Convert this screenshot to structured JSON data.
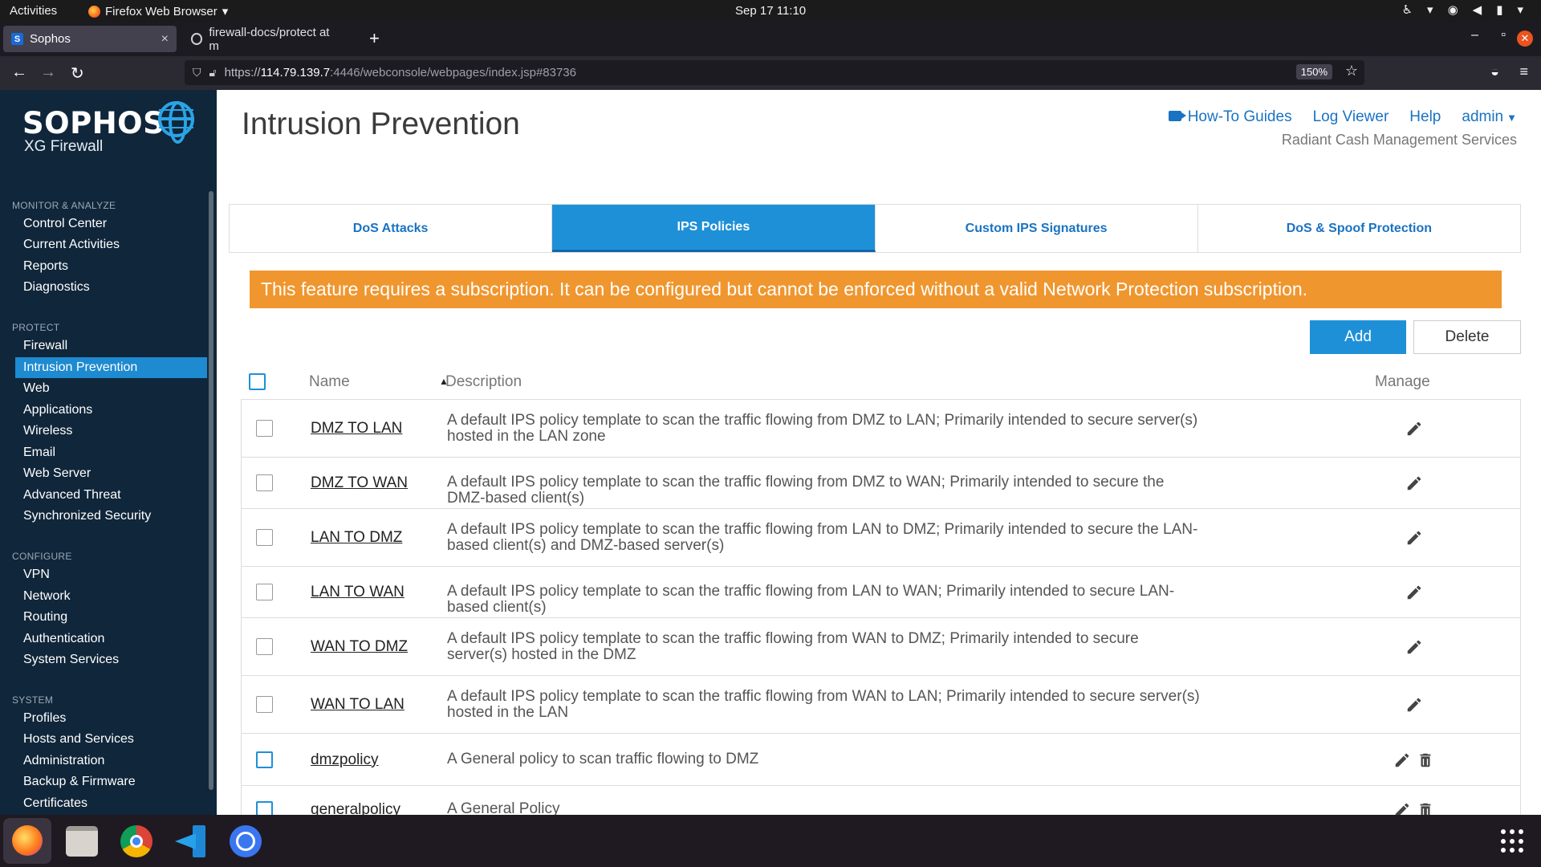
{
  "os": {
    "activities": "Activities",
    "app_menu": "Firefox Web Browser",
    "clock": "Sep 17  11:10"
  },
  "browser": {
    "tabs": [
      {
        "title": "Sophos",
        "favicon": "S"
      },
      {
        "title": "firewall-docs/protect at m"
      }
    ],
    "url_proto": "https://",
    "url_host": "114.79.139.7",
    "url_rest": ":4446/webconsole/webpages/index.jsp#83736",
    "zoom": "150%"
  },
  "sidebar": {
    "logo": "SOPHOS",
    "product": "XG Firewall",
    "sections": [
      {
        "label": "MONITOR & ANALYZE",
        "items": [
          "Control Center",
          "Current Activities",
          "Reports",
          "Diagnostics"
        ]
      },
      {
        "label": "PROTECT",
        "items": [
          "Firewall",
          "Intrusion Prevention",
          "Web",
          "Applications",
          "Wireless",
          "Email",
          "Web Server",
          "Advanced Threat",
          "Synchronized Security"
        ]
      },
      {
        "label": "CONFIGURE",
        "items": [
          "VPN",
          "Network",
          "Routing",
          "Authentication",
          "System Services"
        ]
      },
      {
        "label": "SYSTEM",
        "items": [
          "Profiles",
          "Hosts and Services",
          "Administration",
          "Backup & Firmware",
          "Certificates"
        ]
      }
    ],
    "active_item": "Intrusion Prevention"
  },
  "header": {
    "title": "Intrusion Prevention",
    "links": {
      "howto": "How-To Guides",
      "logviewer": "Log Viewer",
      "help": "Help",
      "user": "admin"
    },
    "organization": "Radiant Cash Management Services"
  },
  "tabs": [
    "DoS Attacks",
    "IPS Policies",
    "Custom IPS Signatures",
    "DoS & Spoof Protection"
  ],
  "active_tab": "IPS Policies",
  "banner": "This feature requires a subscription. It can be configured but cannot be enforced without a valid Network Protection subscription.",
  "actions": {
    "add": "Add",
    "delete": "Delete"
  },
  "table": {
    "columns": {
      "name": "Name",
      "description": "Description",
      "manage": "Manage"
    },
    "rows": [
      {
        "name": "DMZ TO LAN",
        "description": "A default IPS policy template to scan the traffic flowing from DMZ to LAN; Primarily intended to secure server(s) hosted in the LAN zone",
        "deletable": false
      },
      {
        "name": "DMZ TO WAN",
        "description": "A default IPS policy template to scan the traffic flowing from DMZ to WAN; Primarily intended to secure the DMZ-based client(s)",
        "deletable": false
      },
      {
        "name": "LAN TO DMZ",
        "description": "A default IPS policy template to scan the traffic flowing from LAN to DMZ; Primarily intended to secure the LAN-based client(s) and DMZ-based server(s)",
        "deletable": false
      },
      {
        "name": "LAN TO WAN",
        "description": "A default IPS policy template to scan the traffic flowing from LAN to WAN; Primarily intended to secure LAN-based client(s)",
        "deletable": false
      },
      {
        "name": "WAN TO DMZ",
        "description": "A default IPS policy template to scan the traffic flowing from WAN to DMZ; Primarily intended to secure server(s) hosted in the DMZ",
        "deletable": false
      },
      {
        "name": "WAN TO LAN",
        "description": "A default IPS policy template to scan the traffic flowing from WAN to LAN; Primarily intended to secure server(s) hosted in the LAN",
        "deletable": false
      },
      {
        "name": "dmzpolicy",
        "description": "A General policy to scan traffic flowing to DMZ",
        "deletable": true
      },
      {
        "name": "generalpolicy",
        "description": "A General Policy",
        "deletable": true
      }
    ]
  },
  "dock": [
    "firefox-icon",
    "files-icon",
    "chrome-icon",
    "vscode-icon",
    "signal-icon",
    "app-grid-icon"
  ]
}
